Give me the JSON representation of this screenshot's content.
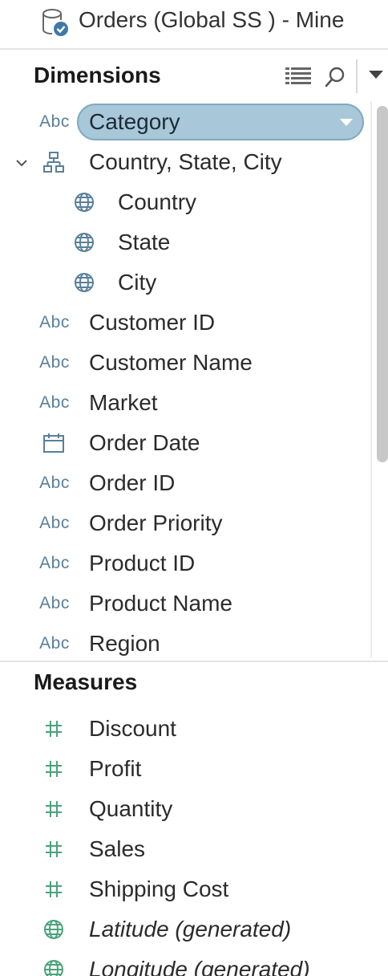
{
  "datasource": {
    "title": "Orders (Global SS ) - Mine",
    "icon": "database-check-icon"
  },
  "dimensions": {
    "title": "Dimensions",
    "toolbar": {
      "list_icon": "list-view-icon",
      "search_icon": "search-icon",
      "menu_icon": "dropdown-caret-icon"
    },
    "selected_field": {
      "label": "Category",
      "type": "Abc"
    },
    "hierarchy": {
      "label": "Country, State, City",
      "icon": "hierarchy-icon",
      "children": [
        {
          "label": "Country",
          "icon": "globe-icon"
        },
        {
          "label": "State",
          "icon": "globe-icon"
        },
        {
          "label": "City",
          "icon": "globe-icon"
        }
      ]
    },
    "fields": [
      {
        "type": "Abc",
        "label": "Customer ID"
      },
      {
        "type": "Abc",
        "label": "Customer Name"
      },
      {
        "type": "Abc",
        "label": "Market"
      },
      {
        "type": "calendar-icon",
        "label": "Order Date"
      },
      {
        "type": "Abc",
        "label": "Order ID"
      },
      {
        "type": "Abc",
        "label": "Order Priority"
      },
      {
        "type": "Abc",
        "label": "Product ID"
      },
      {
        "type": "Abc",
        "label": "Product Name"
      },
      {
        "type": "Abc",
        "label": "Region"
      }
    ]
  },
  "measures": {
    "title": "Measures",
    "fields": [
      {
        "type": "hash-icon",
        "label": "Discount"
      },
      {
        "type": "hash-icon",
        "label": "Profit"
      },
      {
        "type": "hash-icon",
        "label": "Quantity"
      },
      {
        "type": "hash-icon",
        "label": "Sales"
      },
      {
        "type": "hash-icon",
        "label": "Shipping Cost"
      },
      {
        "type": "globe-icon",
        "label": "Latitude (generated)"
      },
      {
        "type": "globe-icon",
        "label": "Longitude (generated)"
      }
    ]
  },
  "colors": {
    "dimension_blue": "#5a7f9a",
    "measure_green": "#4aa37a",
    "pill_fill": "#a8c8d9"
  }
}
